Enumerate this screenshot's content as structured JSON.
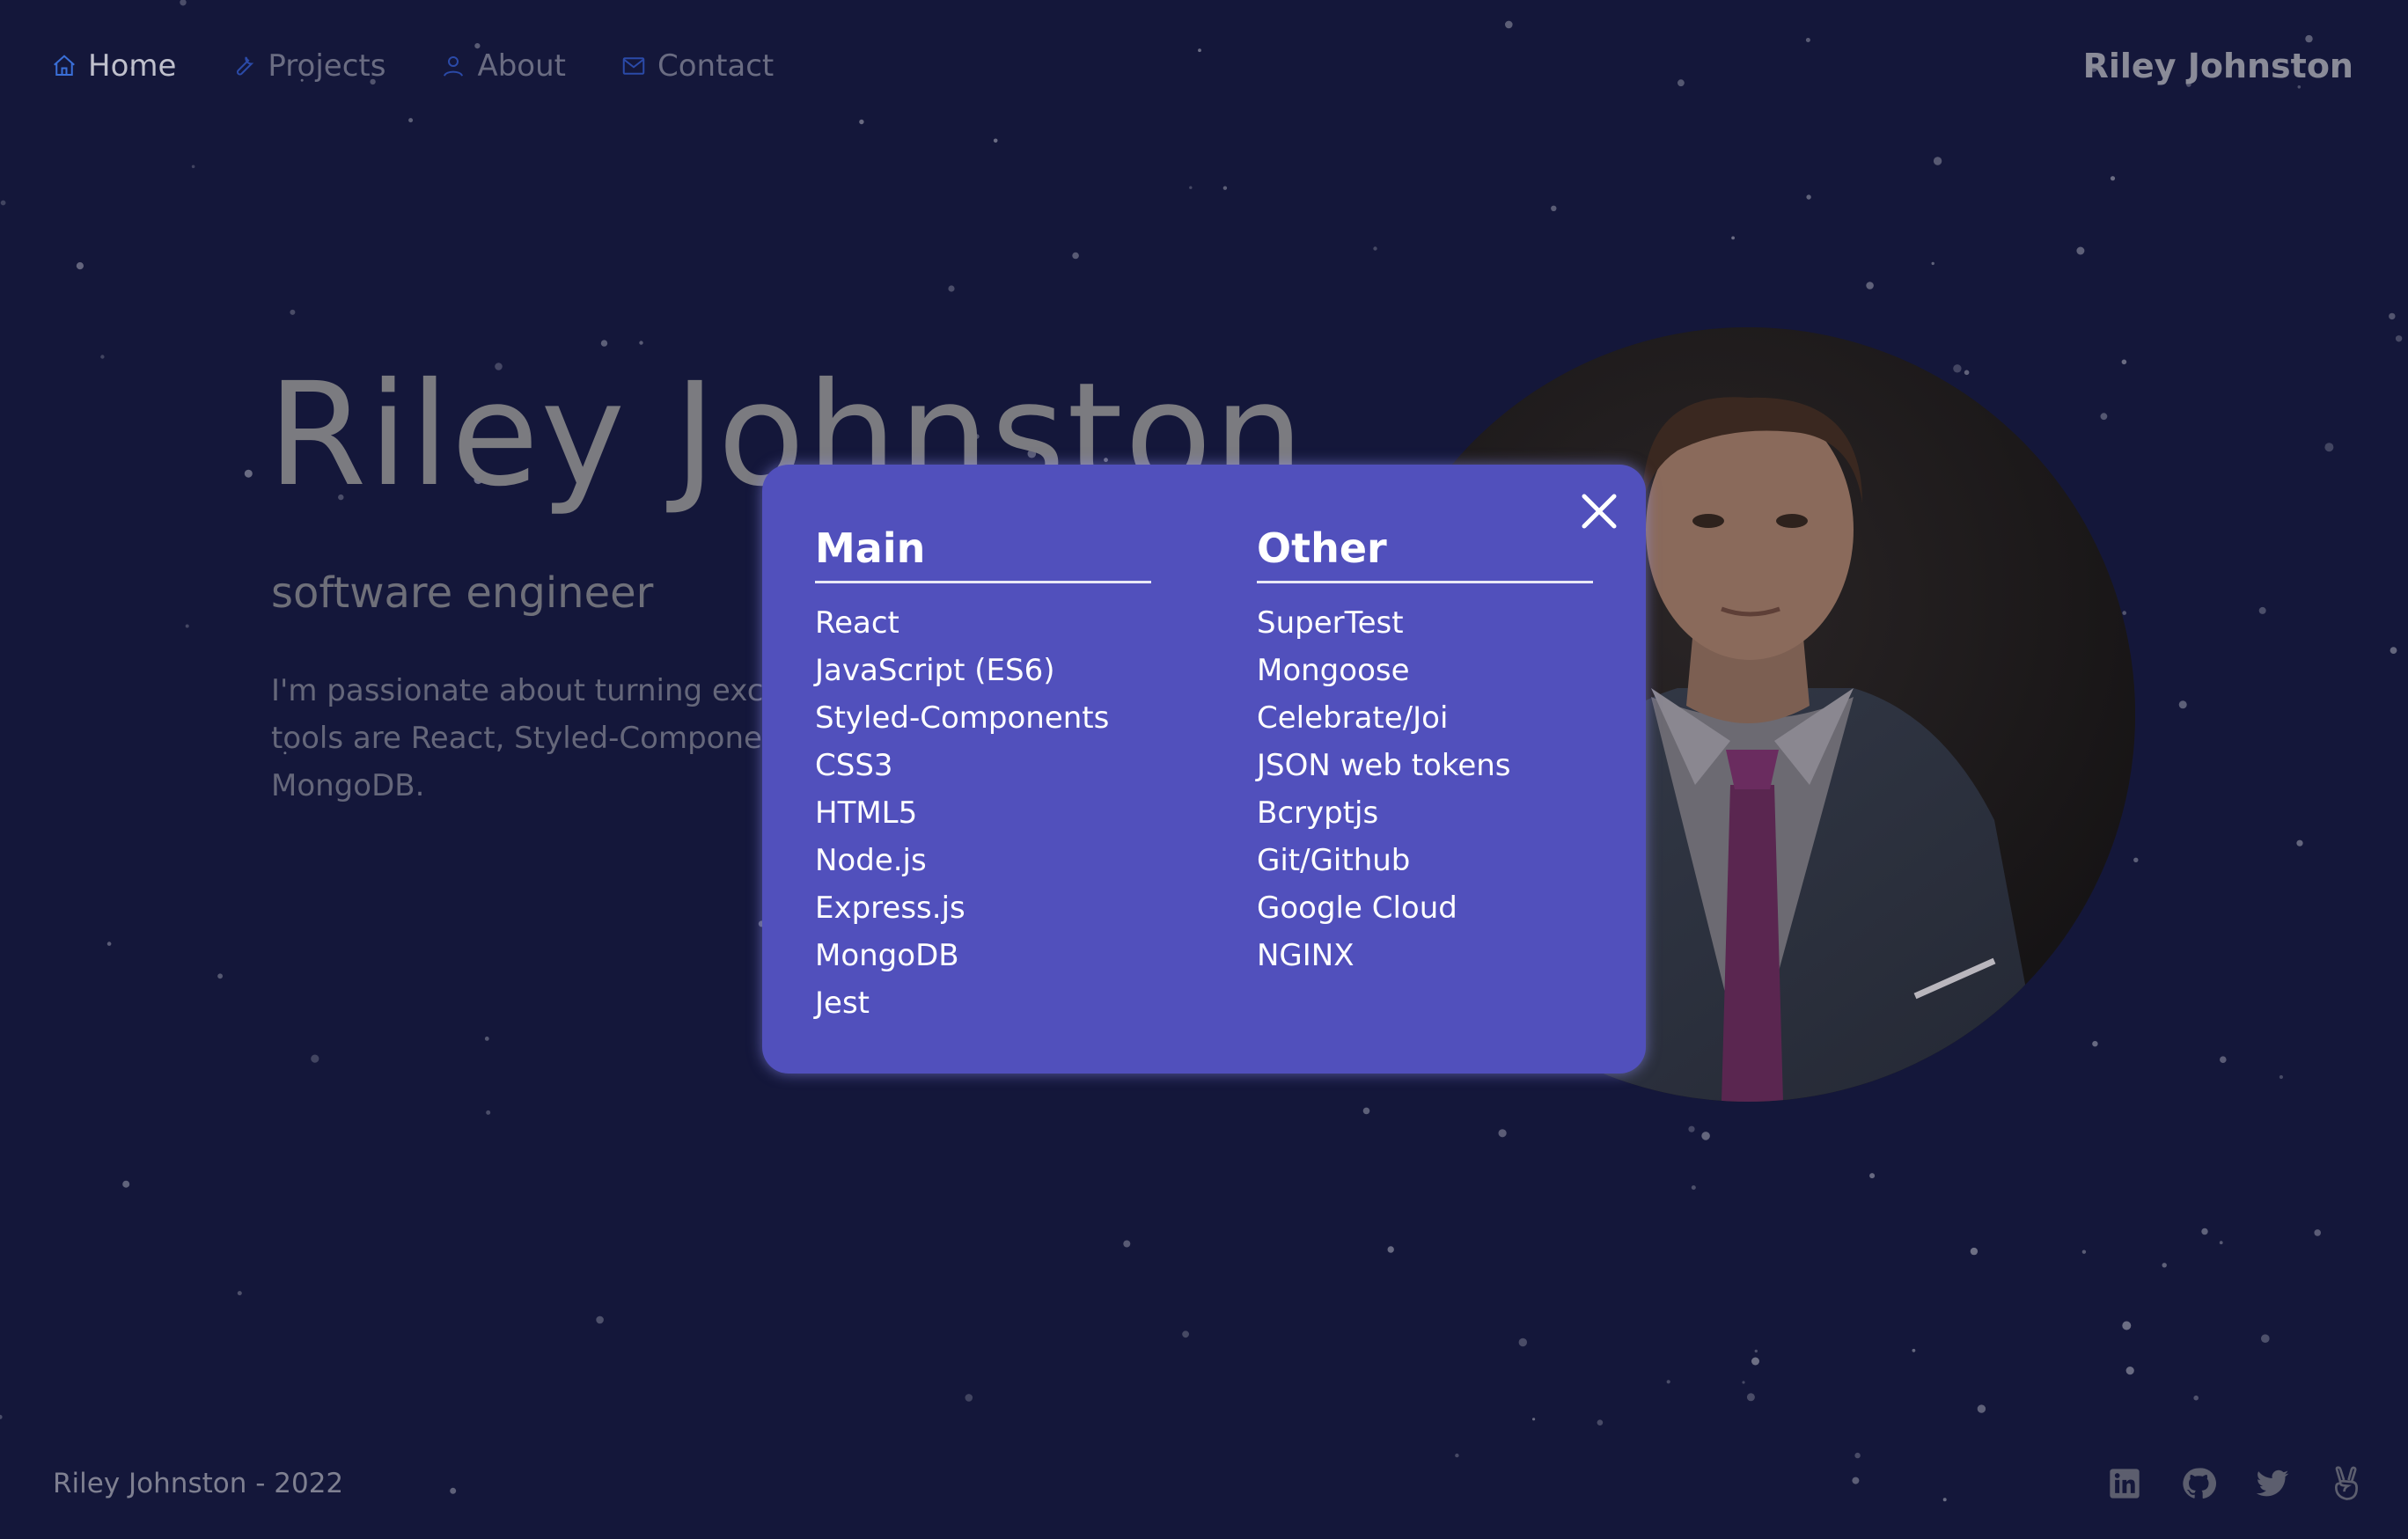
{
  "nav": {
    "items": [
      {
        "label": "Home",
        "icon": "home-icon",
        "active": true
      },
      {
        "label": "Projects",
        "icon": "wrench-icon",
        "active": false
      },
      {
        "label": "About",
        "icon": "user-icon",
        "active": false
      },
      {
        "label": "Contact",
        "icon": "mail-icon",
        "active": false
      }
    ],
    "brand": "Riley Johnston"
  },
  "hero": {
    "name": "Riley Johnston",
    "role": "software engineer",
    "description_lines": [
      "I'm passionate about turning exc",
      "tools are React, Styled-Compone",
      "MongoDB."
    ]
  },
  "modal": {
    "main_title": "Main",
    "main_items": [
      "React",
      "JavaScript (ES6)",
      "Styled-Components",
      "CSS3",
      "HTML5",
      "Node.js",
      "Express.js",
      "MongoDB",
      "Jest"
    ],
    "other_title": "Other",
    "other_items": [
      "SuperTest",
      "Mongoose",
      "Celebrate/Joi",
      "JSON web tokens",
      "Bcryptjs",
      "Git/Github",
      "Google Cloud",
      "NGINX"
    ],
    "close_icon": "close-icon"
  },
  "footer": {
    "copyright": "Riley Johnston - 2022",
    "social_icons": [
      "linkedin-icon",
      "github-icon",
      "twitter-icon",
      "angellist-icon"
    ]
  },
  "colors": {
    "background": "#14173a",
    "modal": "#5150bc",
    "text_muted": "#7b7b80",
    "text_white": "#ffffff"
  }
}
